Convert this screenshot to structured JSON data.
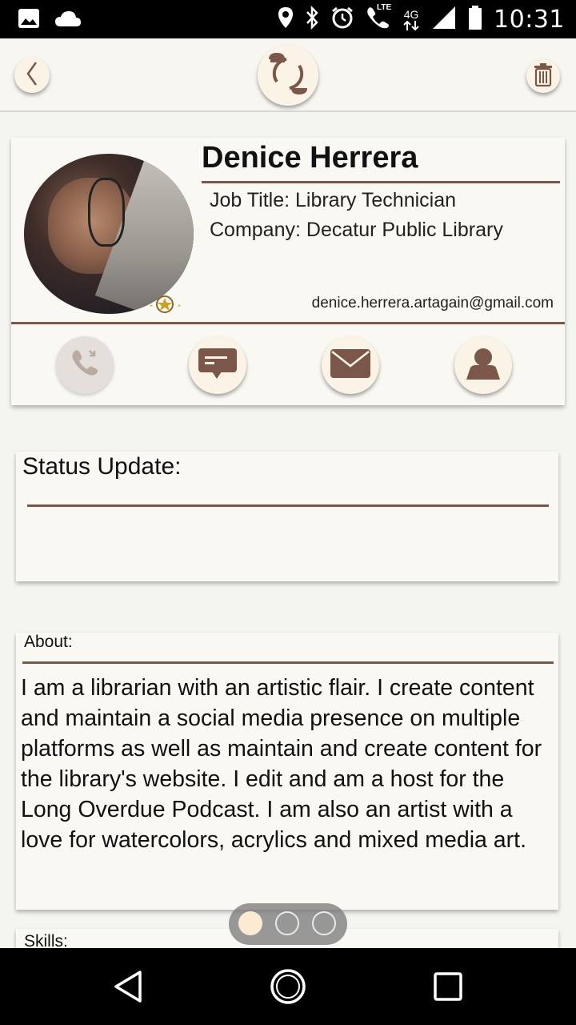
{
  "status_bar": {
    "time": "10:31",
    "icons": [
      "image-icon",
      "cloud-icon",
      "location-icon",
      "bluetooth-icon",
      "alarm-icon",
      "lte-call-icon",
      "4g-data-icon",
      "signal-icon",
      "battery-icon"
    ],
    "network_label": "4G",
    "lte_label": "LTE"
  },
  "app_bar": {
    "icons": [
      "back-icon",
      "sync-icon",
      "trash-icon"
    ]
  },
  "profile": {
    "name": "Denice Herrera",
    "job_title": "Job Title: Library Technician",
    "company": "Company: Decatur Public Library",
    "email": "denice.herrera.artagain@gmail.com",
    "actions": [
      "phone-icon",
      "message-icon",
      "mail-icon",
      "contact-icon"
    ]
  },
  "status_update": {
    "label": "Status Update:",
    "text": ""
  },
  "about": {
    "label": "About:",
    "text": "I am a librarian with an artistic flair. I create content and maintain a social media presence on multiple platforms as well as maintain and create content for the library's website. I edit and am a host for the Long Overdue Podcast. I am also an artist with a love for watercolors, acrylics and mixed media art."
  },
  "skills": {
    "label": "Skills:"
  },
  "pager": {
    "total": 3,
    "active_index": 0
  },
  "colors": {
    "accent": "#7a5748",
    "button_bg": "#fbf3e6",
    "card_bg": "#f9f8f3"
  }
}
